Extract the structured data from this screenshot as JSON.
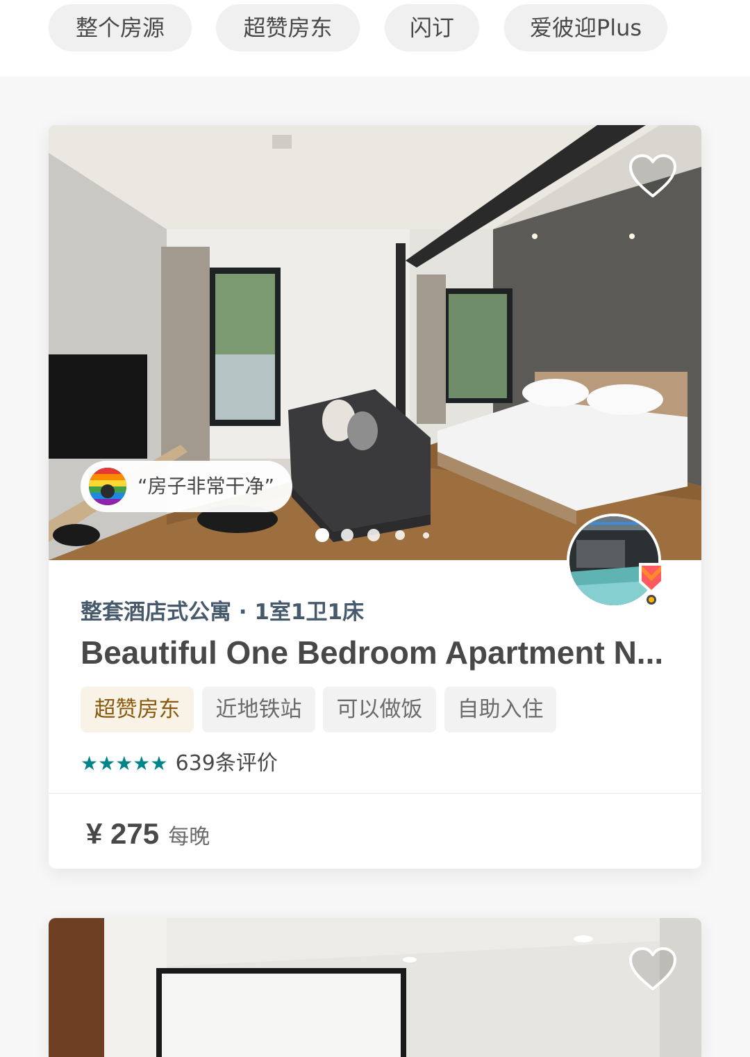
{
  "filters": {
    "chips": [
      "整个房源",
      "超赞房东",
      "闪订",
      "爱彼迎Plus"
    ]
  },
  "listing": {
    "review_snippet": "“房子非常干净”",
    "room_type": "整套酒店式公寓 · 1室1卫1床",
    "title": "Beautiful One Bedroom Apartment N...",
    "tags": [
      "超赞房东",
      "近地铁站",
      "可以做饭",
      "自助入住"
    ],
    "rating_stars": "★★★★★",
    "rating_value": 5,
    "review_count": "639条评价",
    "price": "¥ 275",
    "price_unit": "每晚",
    "photo_count": 5,
    "active_photo": 1
  },
  "icons": {
    "favorite": "heart-outline-icon",
    "superhost": "superhost-badge-icon"
  },
  "colors": {
    "accent_teal": "#008489",
    "room_type": "#465a6c",
    "superhost_badge": "#ff5a5f",
    "superhost_tag_text": "#8a5a0c"
  }
}
